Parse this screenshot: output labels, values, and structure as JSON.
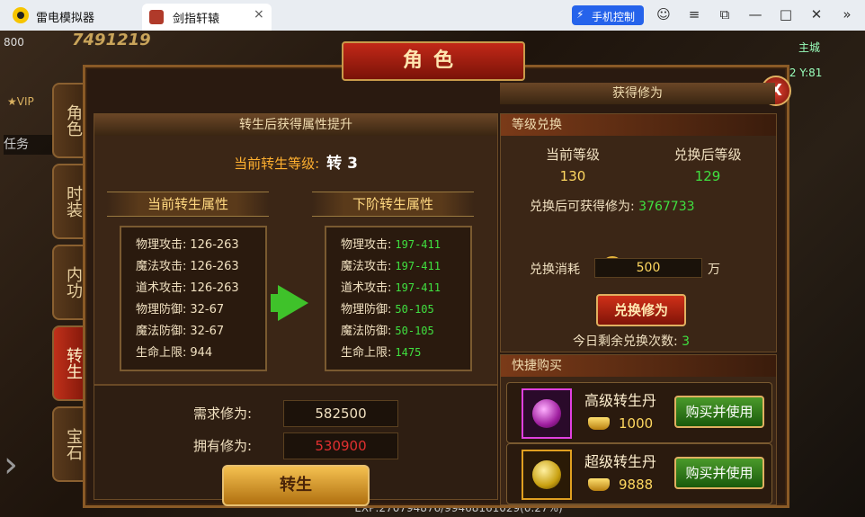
{
  "titlebar": {
    "app_name": "雷电模拟器",
    "tab_label": "剑指轩辕",
    "tab_close": "×",
    "phone_control": "手机控制"
  },
  "hud": {
    "power_value": "7491219",
    "level_tag": "800",
    "vip": "VIP",
    "task": "任务",
    "city": "主城",
    "coord": "X:72 Y:81",
    "exp": "EXP:270794876/99468161029(0.27%)"
  },
  "panel": {
    "title": "角色",
    "close": "X",
    "side_tabs": [
      "角色",
      "时装",
      "内功",
      "转生",
      "宝石"
    ],
    "active_tab": "转生"
  },
  "rebirth": {
    "header": "转生后获得属性提升",
    "current_level_label": "当前转生等级:",
    "current_level_value": "转 3",
    "current_attr_header": "当前转生属性",
    "next_attr_header": "下阶转生属性",
    "current_attrs": [
      {
        "label": "物理攻击:",
        "value": "126-263"
      },
      {
        "label": "魔法攻击:",
        "value": "126-263"
      },
      {
        "label": "道术攻击:",
        "value": "126-263"
      },
      {
        "label": "物理防御:",
        "value": "32-67"
      },
      {
        "label": "魔法防御:",
        "value": "32-67"
      },
      {
        "label": "生命上限:",
        "value": "944"
      }
    ],
    "next_attrs": [
      {
        "label": "物理攻击:",
        "value": "197-411"
      },
      {
        "label": "魔法攻击:",
        "value": "197-411"
      },
      {
        "label": "道术攻击:",
        "value": "197-411"
      },
      {
        "label": "物理防御:",
        "value": "50-105"
      },
      {
        "label": "魔法防御:",
        "value": "50-105"
      },
      {
        "label": "生命上限:",
        "value": "1475"
      }
    ],
    "required_label": "需求修为:",
    "required_value": "582500",
    "owned_label": "拥有修为:",
    "owned_value": "530900",
    "button": "转生"
  },
  "obtain": {
    "header": "获得修为",
    "exchange_section": "等级兑换",
    "current_level_label": "当前等级",
    "current_level_value": "130",
    "after_level_label": "兑换后等级",
    "after_level_value": "129",
    "gain_label": "兑换后可获得修为:",
    "gain_value": "3767733",
    "cost_label": "兑换消耗",
    "cost_value": "500",
    "cost_unit": "万",
    "exchange_button": "兑换修为",
    "remaining_label": "今日剩余兑换次数:",
    "remaining_value": "3",
    "quick_buy_section": "快捷购买",
    "items": [
      {
        "name": "高级转生丹",
        "price": "1000",
        "button": "购买并使用"
      },
      {
        "name": "超级转生丹",
        "price": "9888",
        "button": "购买并使用"
      }
    ]
  }
}
